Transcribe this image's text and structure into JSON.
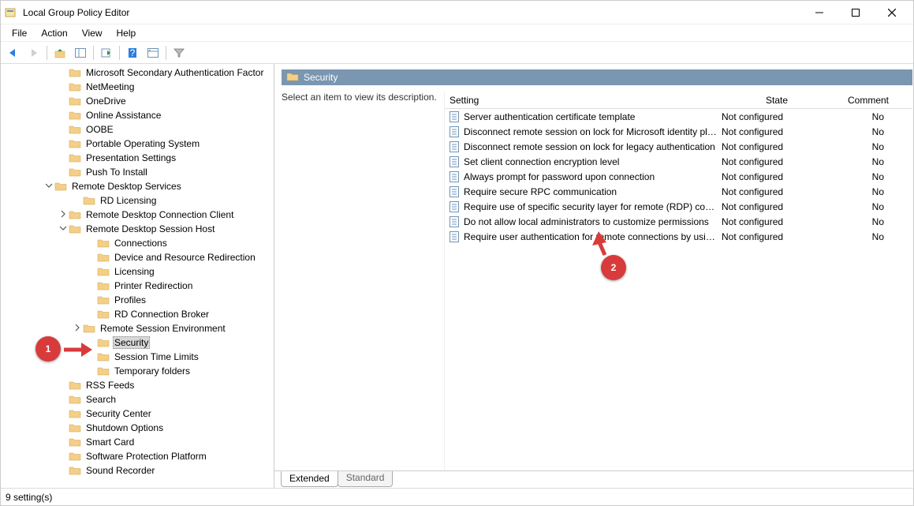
{
  "window": {
    "title": "Local Group Policy Editor"
  },
  "menu": {
    "file": "File",
    "action": "Action",
    "view": "View",
    "help": "Help"
  },
  "toolbar_icons": {
    "back": "back",
    "forward": "forward",
    "up": "up",
    "show": "show",
    "export": "export",
    "help": "help",
    "props": "props",
    "filter": "filter"
  },
  "tree": [
    {
      "indent": 4,
      "label": "Microsoft Secondary Authentication Factor"
    },
    {
      "indent": 4,
      "label": "NetMeeting"
    },
    {
      "indent": 4,
      "label": "OneDrive"
    },
    {
      "indent": 4,
      "label": "Online Assistance"
    },
    {
      "indent": 4,
      "label": "OOBE"
    },
    {
      "indent": 4,
      "label": "Portable Operating System"
    },
    {
      "indent": 4,
      "label": "Presentation Settings"
    },
    {
      "indent": 4,
      "label": "Push To Install"
    },
    {
      "indent": 3,
      "twisty": "v",
      "label": "Remote Desktop Services"
    },
    {
      "indent": 5,
      "label": "RD Licensing"
    },
    {
      "indent": 4,
      "twisty": ">",
      "label": "Remote Desktop Connection Client"
    },
    {
      "indent": 4,
      "twisty": "v",
      "label": "Remote Desktop Session Host"
    },
    {
      "indent": 6,
      "label": "Connections"
    },
    {
      "indent": 6,
      "label": "Device and Resource Redirection"
    },
    {
      "indent": 6,
      "label": "Licensing"
    },
    {
      "indent": 6,
      "label": "Printer Redirection"
    },
    {
      "indent": 6,
      "label": "Profiles"
    },
    {
      "indent": 6,
      "label": "RD Connection Broker"
    },
    {
      "indent": 5,
      "twisty": ">",
      "label": "Remote Session Environment"
    },
    {
      "indent": 6,
      "label": "Security",
      "selected": true
    },
    {
      "indent": 6,
      "label": "Session Time Limits"
    },
    {
      "indent": 6,
      "label": "Temporary folders"
    },
    {
      "indent": 4,
      "label": "RSS Feeds"
    },
    {
      "indent": 4,
      "label": "Search"
    },
    {
      "indent": 4,
      "label": "Security Center"
    },
    {
      "indent": 4,
      "label": "Shutdown Options"
    },
    {
      "indent": 4,
      "label": "Smart Card"
    },
    {
      "indent": 4,
      "label": "Software Protection Platform"
    },
    {
      "indent": 4,
      "label": "Sound Recorder"
    }
  ],
  "right": {
    "path_label": "Security",
    "description_prompt": "Select an item to view its description.",
    "columns": {
      "setting": "Setting",
      "state": "State",
      "comment": "Comment"
    },
    "rows": [
      {
        "setting": "Server authentication certificate template",
        "state": "Not configured",
        "comment": "No"
      },
      {
        "setting": "Disconnect remote session on lock for Microsoft identity pla...",
        "state": "Not configured",
        "comment": "No"
      },
      {
        "setting": "Disconnect remote session on lock for legacy authentication",
        "state": "Not configured",
        "comment": "No"
      },
      {
        "setting": "Set client connection encryption level",
        "state": "Not configured",
        "comment": "No"
      },
      {
        "setting": "Always prompt for password upon connection",
        "state": "Not configured",
        "comment": "No"
      },
      {
        "setting": "Require secure RPC communication",
        "state": "Not configured",
        "comment": "No"
      },
      {
        "setting": "Require use of specific security layer for remote (RDP) conn...",
        "state": "Not configured",
        "comment": "No"
      },
      {
        "setting": "Do not allow local administrators to customize permissions",
        "state": "Not configured",
        "comment": "No"
      },
      {
        "setting": "Require user authentication for remote connections by usin...",
        "state": "Not configured",
        "comment": "No"
      }
    ],
    "tabs": {
      "extended": "Extended",
      "standard": "Standard"
    }
  },
  "status": {
    "text": "9 setting(s)"
  },
  "callouts": {
    "one": "1",
    "two": "2"
  }
}
